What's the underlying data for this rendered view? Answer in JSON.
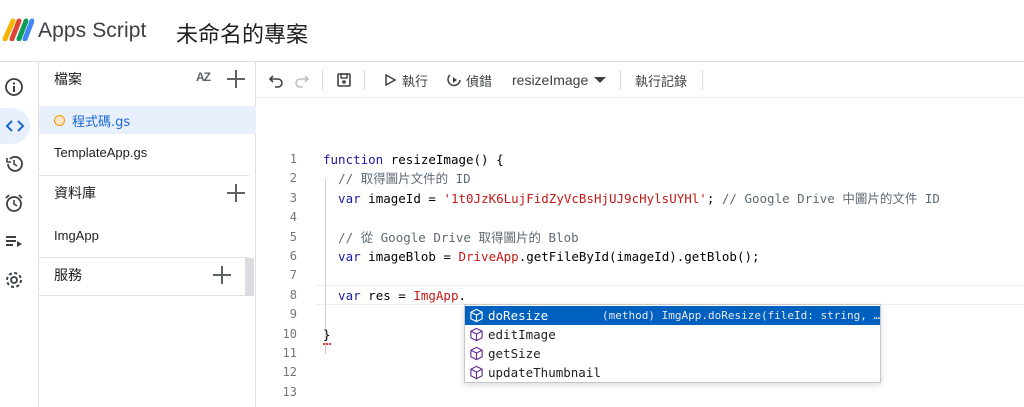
{
  "header": {
    "app_name": "Apps Script",
    "project_title": "未命名的專案"
  },
  "rail": {
    "items": [
      {
        "icon": "info-icon"
      },
      {
        "icon": "code-icon",
        "active": true
      },
      {
        "icon": "history-icon"
      },
      {
        "icon": "alarm-icon"
      },
      {
        "icon": "executions-icon"
      },
      {
        "icon": "gear-icon"
      }
    ]
  },
  "files_panel": {
    "files_label": "檔案",
    "sort_label": "AZ",
    "files": [
      "程式碼.gs",
      "TemplateApp.gs"
    ],
    "libraries_label": "資料庫",
    "libraries": [
      "ImgApp"
    ],
    "services_label": "服務"
  },
  "toolbar": {
    "run_label": "執行",
    "debug_label": "偵錯",
    "function_select": "resizeImage",
    "log_label": "執行記錄"
  },
  "editor": {
    "lines": [
      {
        "n": "1",
        "parts": [
          {
            "c": "kw",
            "t": "function"
          },
          {
            "c": "fn",
            "t": " resizeImage() {"
          }
        ]
      },
      {
        "n": "2",
        "parts": [
          {
            "c": "cm",
            "t": "  // 取得圖片文件的 ID"
          }
        ]
      },
      {
        "n": "3",
        "parts": [
          {
            "c": "kw",
            "t": "  var"
          },
          {
            "c": "fn",
            "t": " imageId = "
          },
          {
            "c": "str",
            "t": "'1t0JzK6LujFidZyVcBsHjUJ9cHylsUYHl'"
          },
          {
            "c": "fn",
            "t": "; "
          },
          {
            "c": "cm",
            "t": "// Google Drive 中圖片的文件 ID"
          }
        ]
      },
      {
        "n": "4",
        "parts": []
      },
      {
        "n": "5",
        "parts": [
          {
            "c": "cm",
            "t": "  // 從 Google Drive 取得圖片的 Blob"
          }
        ]
      },
      {
        "n": "6",
        "parts": [
          {
            "c": "kw",
            "t": "  var"
          },
          {
            "c": "fn",
            "t": " imageBlob = "
          },
          {
            "c": "cls",
            "t": "DriveApp"
          },
          {
            "c": "fn",
            "t": ".getFileById(imageId).getBlob();"
          }
        ]
      },
      {
        "n": "7",
        "parts": []
      },
      {
        "n": "8",
        "parts": [
          {
            "c": "kw",
            "t": "  var"
          },
          {
            "c": "fn",
            "t": " res = "
          },
          {
            "c": "cls",
            "t": "ImgApp"
          },
          {
            "c": "fn",
            "t": "."
          }
        ]
      },
      {
        "n": "9",
        "parts": []
      },
      {
        "n": "10",
        "parts": [
          {
            "c": "fn",
            "t": "}"
          }
        ]
      },
      {
        "n": "11",
        "parts": []
      },
      {
        "n": "12",
        "parts": []
      },
      {
        "n": "13",
        "parts": []
      }
    ]
  },
  "autocomplete": {
    "items": [
      {
        "label": "doResize",
        "detail": "(method) ImgApp.doResize(fileId: string, …",
        "selected": true
      },
      {
        "label": "editImage",
        "detail": ""
      },
      {
        "label": "getSize",
        "detail": ""
      },
      {
        "label": "updateThumbnail",
        "detail": ""
      }
    ]
  },
  "colors": {
    "accent": "#1967d2",
    "selection": "#0060c0",
    "keyword": "#1a1aa6",
    "string": "#c41a16",
    "comment": "#5e6a74"
  }
}
